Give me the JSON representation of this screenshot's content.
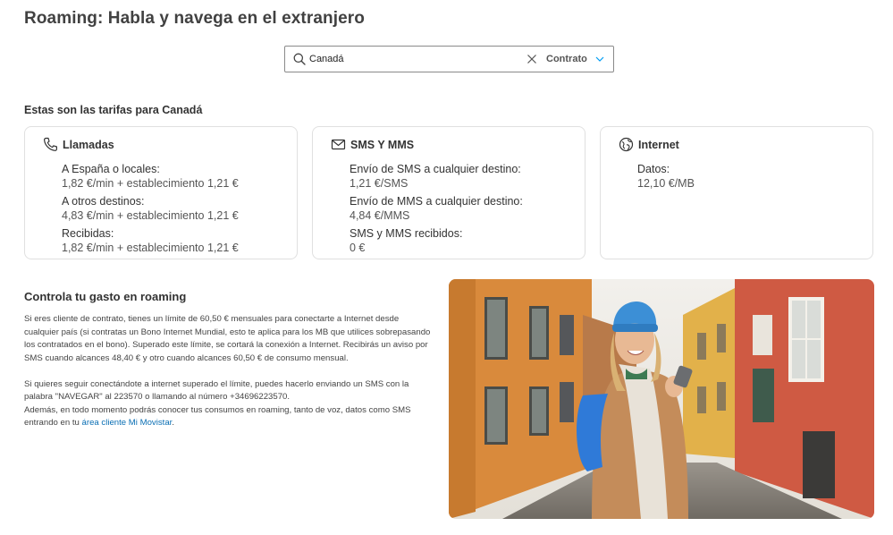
{
  "page": {
    "title": "Roaming: Habla y navega en el extranjero"
  },
  "search": {
    "value": "Canadá",
    "plan_label": "Contrato"
  },
  "rates": {
    "heading": "Estas son las tarifas para Canadá",
    "calls": {
      "title": "Llamadas",
      "items": [
        {
          "label": "A España o locales:",
          "value": "1,82 €/min + establecimiento 1,21 €"
        },
        {
          "label": "A otros destinos:",
          "value": "4,83 €/min + establecimiento 1,21 €"
        },
        {
          "label": "Recibidas:",
          "value": "1,82 €/min + establecimiento 1,21 €"
        }
      ]
    },
    "sms": {
      "title": "SMS Y MMS",
      "items": [
        {
          "label": "Envío de SMS a cualquier destino:",
          "value": "1,21 €/SMS"
        },
        {
          "label": "Envío de MMS a cualquier destino:",
          "value": "4,84 €/MMS"
        },
        {
          "label": "SMS y MMS recibidos:",
          "value": "0 €"
        }
      ]
    },
    "internet": {
      "title": "Internet",
      "items": [
        {
          "label": "Datos:",
          "value": "12,10 €/MB"
        }
      ]
    }
  },
  "control": {
    "title": "Controla tu gasto en roaming",
    "paragraph1": "Si eres cliente de contrato, tienes un límite de 60,50 € mensuales para conectarte a Internet desde cualquier país (si contratas un Bono Internet Mundial, esto te aplica para los MB que utilices sobrepasando los contratados en el bono). Superado este límite, se cortará la conexión a Internet. Recibirás un aviso por SMS cuando alcances 48,40 € y otro cuando alcances 60,50 € de consumo mensual.",
    "paragraph2": "Si quieres seguir conectándote a internet superado el límite, puedes hacerlo enviando un SMS con la palabra \"NAVEGAR\" al 223570 o llamando al número +34696223570.",
    "paragraph3_prefix": "Además, en todo momento podrás conocer tus consumos en roaming, tanto de voz, datos como SMS entrando en tu ",
    "link_text": "área cliente Mi Movistar",
    "paragraph3_suffix": "."
  },
  "icons": {
    "search": "search-icon",
    "clear": "close-icon",
    "dropdown": "chevron-down-icon",
    "calls": "phone-icon",
    "sms": "envelope-icon",
    "internet": "globe-icon"
  },
  "colors": {
    "link": "#0b6fb4",
    "brand": "#019df4"
  }
}
